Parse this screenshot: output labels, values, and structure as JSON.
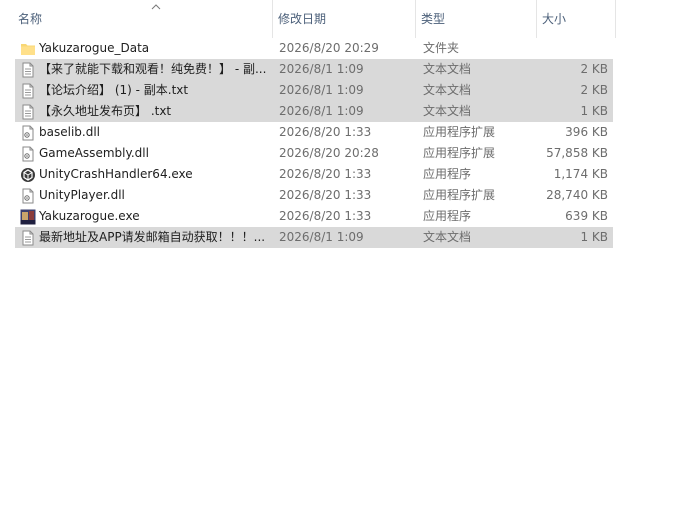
{
  "columns": {
    "name": "名称",
    "date": "修改日期",
    "type": "类型",
    "size": "大小"
  },
  "files": [
    {
      "name": "Yakuzarogue_Data",
      "date": "2026/8/20 20:29",
      "type": "文件夹",
      "size": "",
      "icon": "folder-icon",
      "selected": false
    },
    {
      "name": "【来了就能下载和观看！纯免费！】 - 副...",
      "date": "2026/8/1 1:09",
      "type": "文本文档",
      "size": "2 KB",
      "icon": "text-file-icon",
      "selected": true
    },
    {
      "name": "【论坛介绍】 (1) - 副本.txt",
      "date": "2026/8/1 1:09",
      "type": "文本文档",
      "size": "2 KB",
      "icon": "text-file-icon",
      "selected": true
    },
    {
      "name": "【永久地址发布页】 .txt",
      "date": "2026/8/1 1:09",
      "type": "文本文档",
      "size": "1 KB",
      "icon": "text-file-icon",
      "selected": true
    },
    {
      "name": "baselib.dll",
      "date": "2026/8/20 1:33",
      "type": "应用程序扩展",
      "size": "396 KB",
      "icon": "dll-file-icon",
      "selected": false
    },
    {
      "name": "GameAssembly.dll",
      "date": "2026/8/20 20:28",
      "type": "应用程序扩展",
      "size": "57,858 KB",
      "icon": "dll-file-icon",
      "selected": false
    },
    {
      "name": "UnityCrashHandler64.exe",
      "date": "2026/8/20 1:33",
      "type": "应用程序",
      "size": "1,174 KB",
      "icon": "unity-exe-icon",
      "selected": false
    },
    {
      "name": "UnityPlayer.dll",
      "date": "2026/8/20 1:33",
      "type": "应用程序扩展",
      "size": "28,740 KB",
      "icon": "dll-file-icon",
      "selected": false
    },
    {
      "name": "Yakuzarogue.exe",
      "date": "2026/8/20 1:33",
      "type": "应用程序",
      "size": "639 KB",
      "icon": "game-exe-icon",
      "selected": false
    },
    {
      "name": "最新地址及APP请发邮箱自动获取！！！...",
      "date": "2026/8/1 1:09",
      "type": "文本文档",
      "size": "1 KB",
      "icon": "text-file-icon",
      "selected": true
    }
  ]
}
